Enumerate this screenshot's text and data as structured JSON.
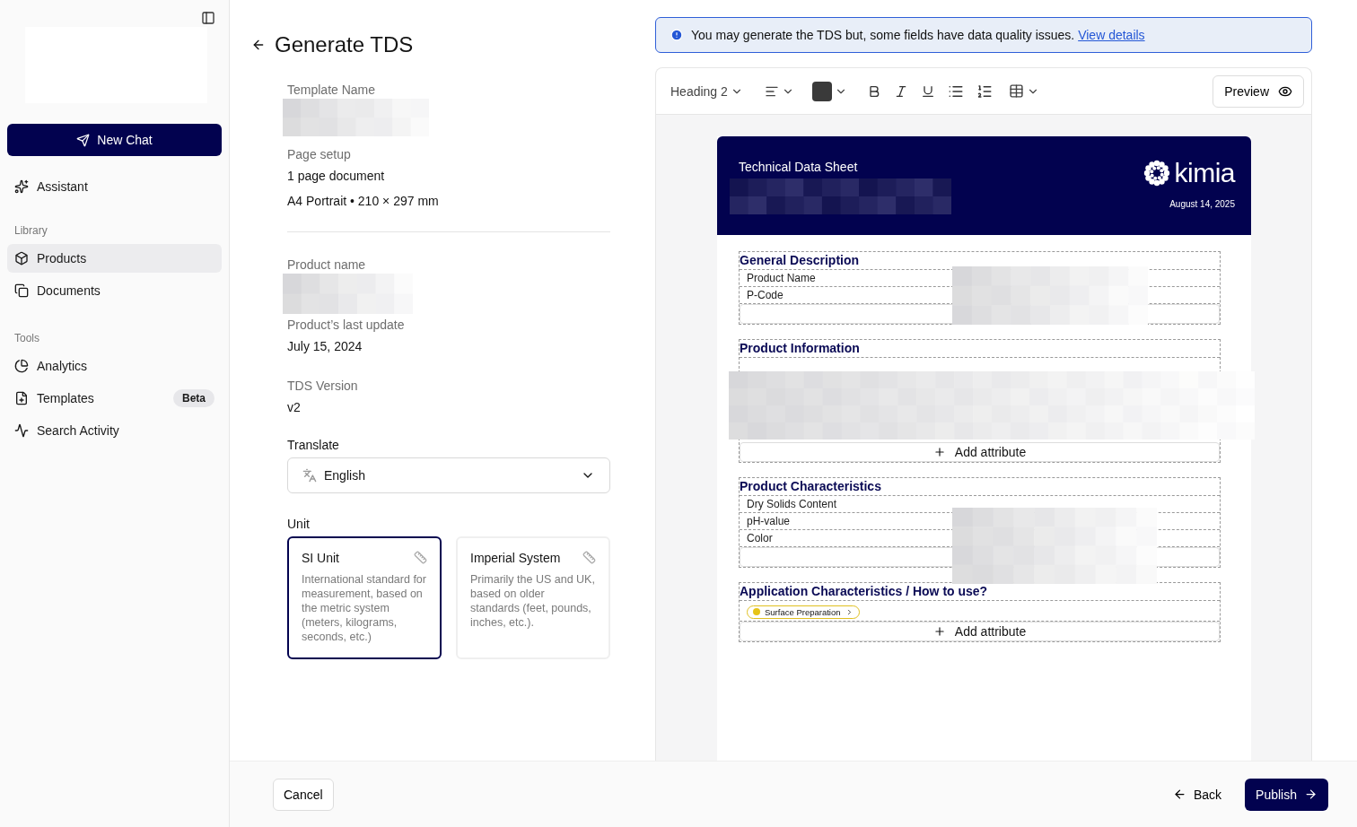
{
  "sidebar": {
    "new_chat": "New Chat",
    "assistant": "Assistant",
    "sections": [
      {
        "heading": "Library",
        "items": [
          {
            "label": "Products",
            "selected": true
          },
          {
            "label": "Documents",
            "selected": false
          }
        ]
      },
      {
        "heading": "Tools",
        "items": [
          {
            "label": "Analytics",
            "selected": false
          },
          {
            "label": "Templates",
            "badge": "Beta",
            "selected": false
          },
          {
            "label": "Search Activity",
            "selected": false
          }
        ]
      }
    ]
  },
  "form": {
    "title": "Generate TDS",
    "template_name_label": "Template Name",
    "page_setup_label": "Page setup",
    "page_setup_lines": [
      "1 page document",
      "A4 Portrait • 210 × 297 mm"
    ],
    "product_name_label": "Product name",
    "last_update_label": "Product’s last update",
    "last_update": "July 15, 2024",
    "version_label": "TDS Version",
    "version": "v2",
    "translate_label": "Translate",
    "language": "English",
    "unit_label": "Unit",
    "units": [
      {
        "title": "SI Unit",
        "description": "International standard for measurement, based on the metric system (meters, kilograms, seconds, etc.)",
        "selected": true
      },
      {
        "title": "Imperial System",
        "description": "Primarily  the US and UK, based on older standards (feet, pounds, inches, etc.).",
        "selected": false
      }
    ]
  },
  "banner": {
    "message": "You may generate the TDS but, some fields have data quality issues.",
    "link": "View details"
  },
  "toolbar": {
    "block_style": "Heading 2",
    "preview": "Preview"
  },
  "document": {
    "title": "Technical Data Sheet",
    "brand": "kimia",
    "date": "August 14, 2025",
    "sections": [
      {
        "heading": "General Description",
        "rows": [
          "Product Name",
          "P-Code"
        ]
      },
      {
        "heading": "Product Information",
        "add_label": "Add attribute"
      },
      {
        "heading": "Product Characteristics",
        "rows": [
          "Dry Solids Content",
          "pH-value",
          "Color"
        ]
      },
      {
        "heading": "Application Characteristics / How to use?",
        "chips": [
          "Surface Preparation"
        ],
        "add_label": "Add attribute"
      }
    ]
  },
  "footer": {
    "cancel": "Cancel",
    "back": "Back",
    "publish": "Publish"
  }
}
